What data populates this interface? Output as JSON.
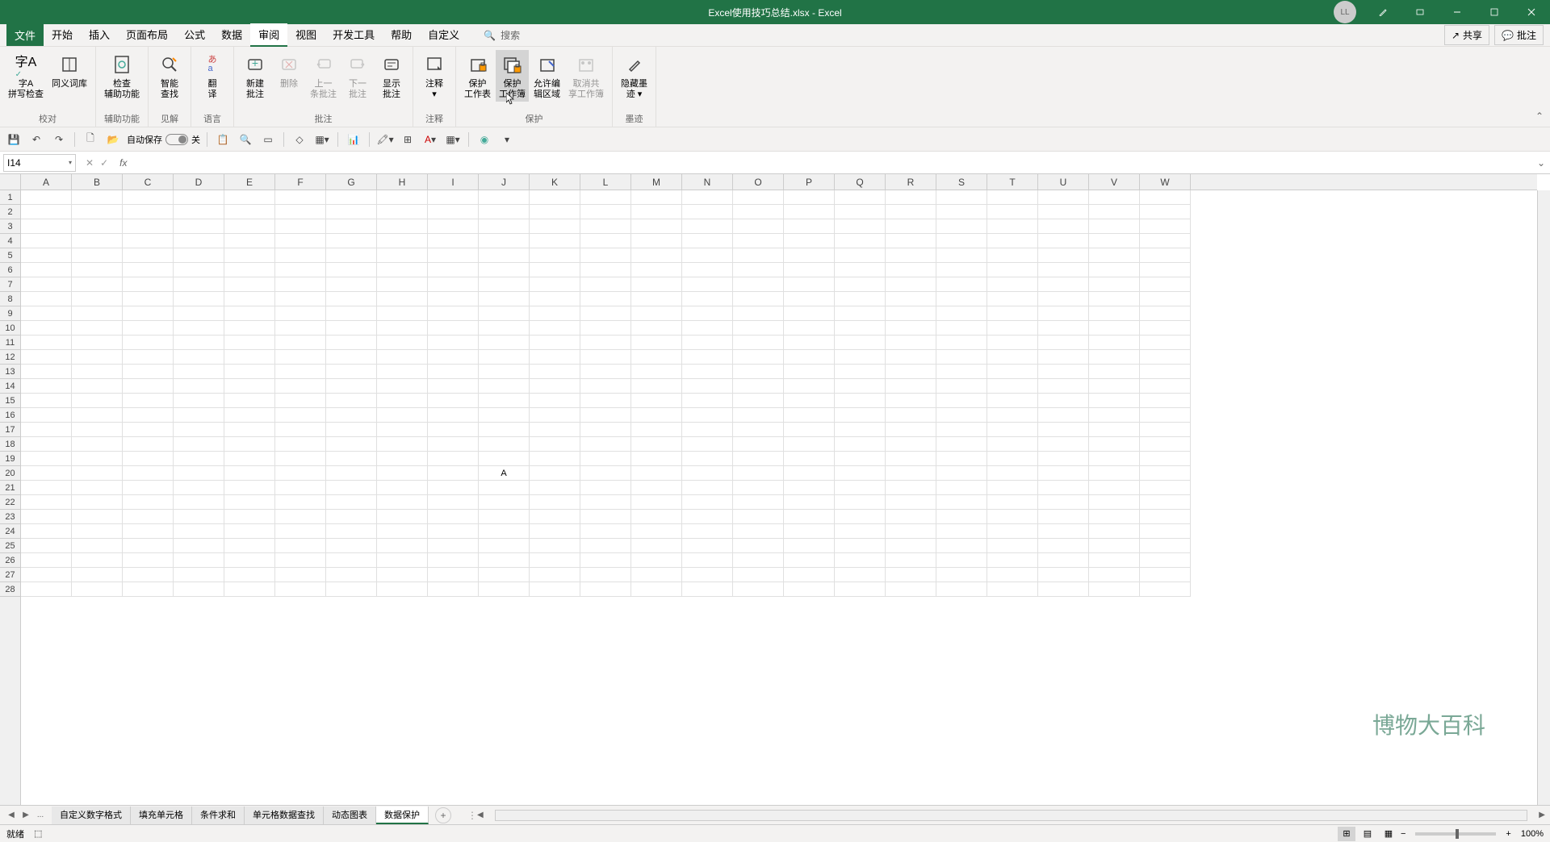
{
  "titlebar": {
    "title": "Excel使用技巧总结.xlsx - Excel",
    "user_initials": "LL"
  },
  "menubar": {
    "file": "文件",
    "items": [
      "开始",
      "插入",
      "页面布局",
      "公式",
      "数据",
      "审阅",
      "视图",
      "开发工具",
      "帮助",
      "自定义"
    ],
    "active_index": 5,
    "search_placeholder": "搜索",
    "share": "共享",
    "comments": "批注"
  },
  "ribbon": {
    "groups": [
      {
        "label": "校对",
        "buttons": [
          {
            "label": "字A\n拼写检查",
            "icon": "spell"
          },
          {
            "label": "同义词库",
            "icon": "book"
          }
        ]
      },
      {
        "label": "辅助功能",
        "buttons": [
          {
            "label": "检查\n辅助功能",
            "icon": "check"
          }
        ]
      },
      {
        "label": "见解",
        "buttons": [
          {
            "label": "智能\n查找",
            "icon": "search"
          }
        ]
      },
      {
        "label": "语言",
        "buttons": [
          {
            "label": "翻\n译",
            "icon": "translate"
          }
        ]
      },
      {
        "label": "批注",
        "buttons": [
          {
            "label": "新建\n批注",
            "icon": "newcomment"
          },
          {
            "label": "删除",
            "icon": "delete",
            "disabled": true
          },
          {
            "label": "上一\n条批注",
            "icon": "prev",
            "disabled": true
          },
          {
            "label": "下一\n批注",
            "icon": "next",
            "disabled": true
          },
          {
            "label": "显示\n批注",
            "icon": "show"
          }
        ]
      },
      {
        "label": "注释",
        "buttons": [
          {
            "label": "注释\n▾",
            "icon": "notes"
          }
        ]
      },
      {
        "label": "保护",
        "buttons": [
          {
            "label": "保护\n工作表",
            "icon": "protectsheet"
          },
          {
            "label": "保护\n工作簿",
            "icon": "protectbook",
            "highlighted": true
          },
          {
            "label": "允许编\n辑区域",
            "icon": "alloweditrange"
          },
          {
            "label": "取消共\n享工作簿",
            "icon": "unshare",
            "disabled": true
          }
        ]
      },
      {
        "label": "墨迹",
        "buttons": [
          {
            "label": "隐藏墨\n迹 ▾",
            "icon": "ink"
          }
        ]
      }
    ]
  },
  "qat": {
    "autosave_label": "自动保存",
    "autosave_off": "关"
  },
  "formula_bar": {
    "name_box": "I14"
  },
  "grid": {
    "columns": [
      "A",
      "B",
      "C",
      "D",
      "E",
      "F",
      "G",
      "H",
      "I",
      "J",
      "K",
      "L",
      "M",
      "N",
      "O",
      "P",
      "Q",
      "R",
      "S",
      "T",
      "U",
      "V",
      "W"
    ],
    "rows": 28,
    "cell_data": {
      "20_J": "A"
    }
  },
  "sheet_tabs": {
    "ellipsis": "...",
    "tabs": [
      "自定义数字格式",
      "填充单元格",
      "条件求和",
      "单元格数据查找",
      "动态图表",
      "数据保护"
    ],
    "active_index": 5
  },
  "statusbar": {
    "ready": "就绪",
    "zoom": "100%"
  },
  "watermark": "博物大百科"
}
